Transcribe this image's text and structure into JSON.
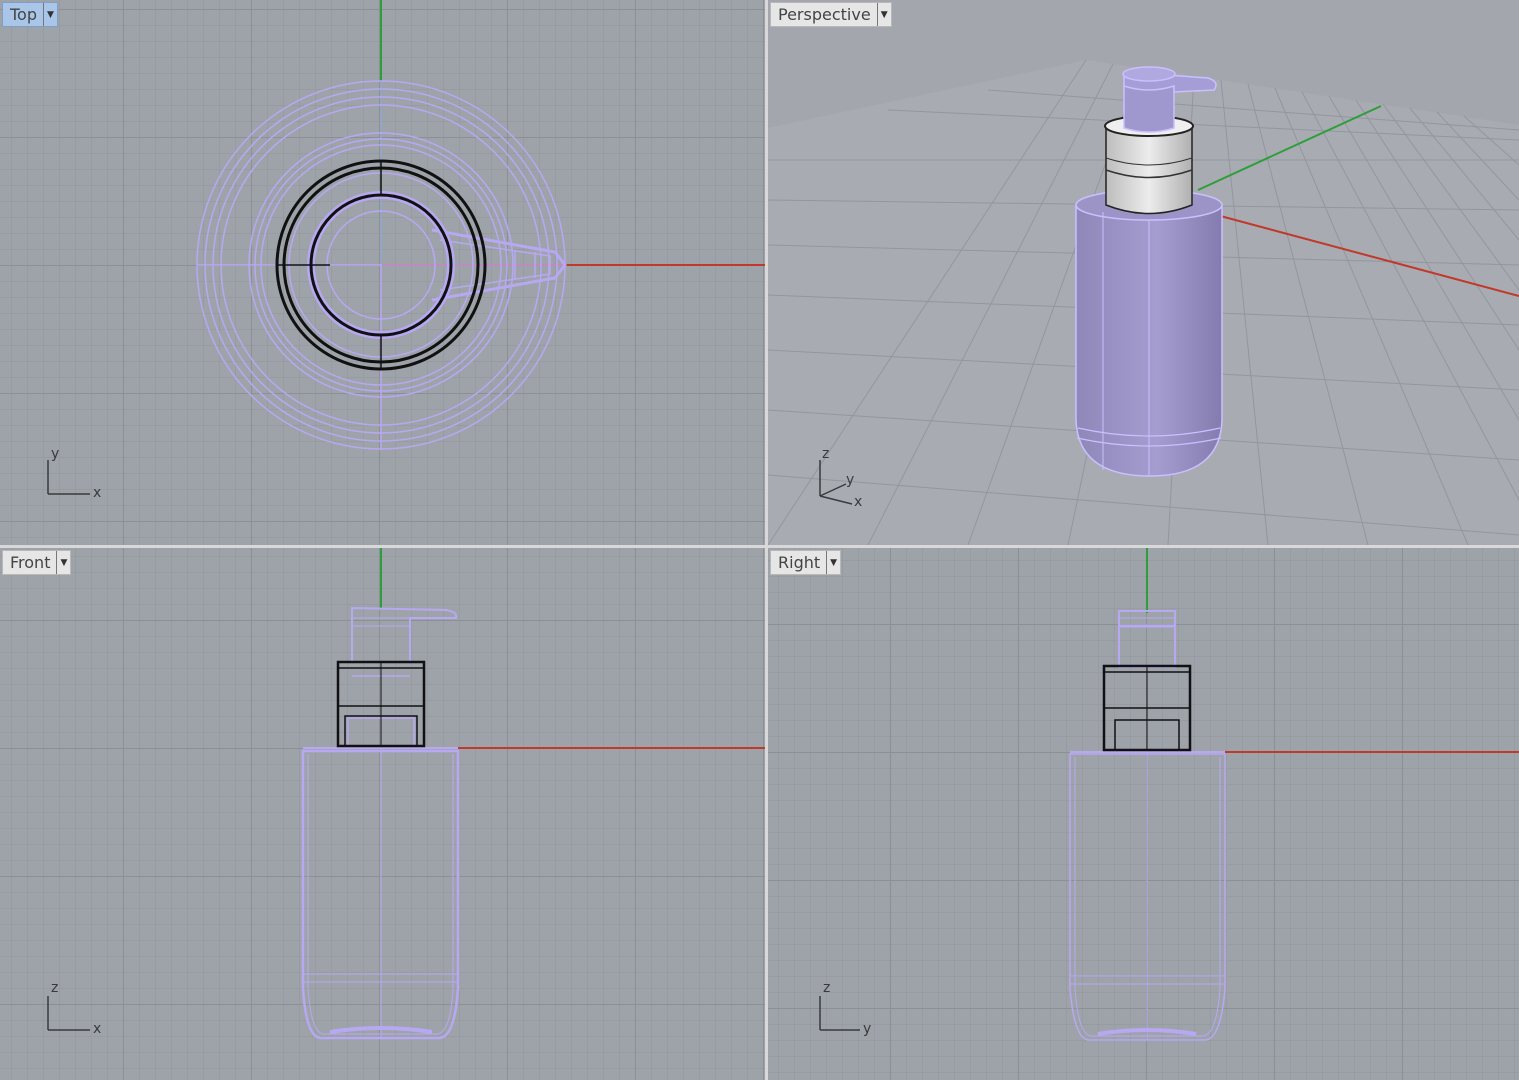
{
  "viewports": {
    "top": {
      "title": "Top",
      "axes": {
        "a": "y",
        "b": "x"
      }
    },
    "perspective": {
      "title": "Perspective",
      "axes": {
        "z": "z",
        "y": "y",
        "x": "x"
      }
    },
    "front": {
      "title": "Front",
      "axes": {
        "a": "z",
        "b": "x"
      }
    },
    "right": {
      "title": "Right",
      "axes": {
        "a": "z",
        "b": "y"
      }
    }
  },
  "colors": {
    "grid_bg": "#9ea3aa",
    "x_axis": "#c0392b",
    "y_axis": "#2e9e3a",
    "wire": "#b7a8f2",
    "selected_black": "#111111",
    "bottle_fill": "#9b93c2",
    "active_tab": "#a9c6e8"
  },
  "icons": {
    "dropdown": "chevron-down-icon"
  }
}
